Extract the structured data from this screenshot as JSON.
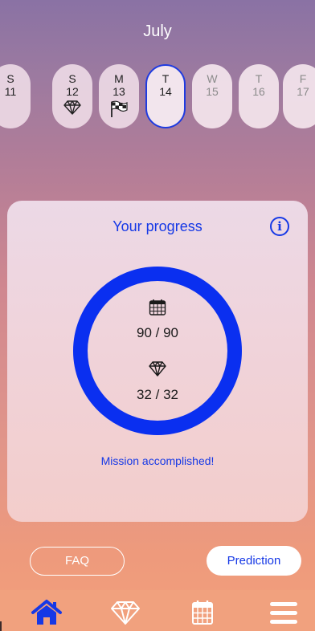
{
  "header": {
    "month": "July"
  },
  "days": [
    {
      "dow": "S",
      "num": "11",
      "marker": "",
      "state": "past"
    },
    {
      "dow": "S",
      "num": "12",
      "marker": "diamond-icon",
      "state": "past"
    },
    {
      "dow": "M",
      "num": "13",
      "marker": "checkered-flag-icon",
      "state": "past"
    },
    {
      "dow": "T",
      "num": "14",
      "marker": "",
      "state": "selected"
    },
    {
      "dow": "W",
      "num": "15",
      "marker": "",
      "state": "future"
    },
    {
      "dow": "T",
      "num": "16",
      "marker": "",
      "state": "future"
    },
    {
      "dow": "F",
      "num": "17",
      "marker": "",
      "state": "future"
    }
  ],
  "progress": {
    "title": "Your progress",
    "info_label": "i",
    "days_text": "90 / 90",
    "diamonds_text": "32 / 32",
    "completion_fraction": 1.0,
    "status": "Mission accomplished!"
  },
  "buttons": {
    "faq": "FAQ",
    "prediction": "Prediction"
  },
  "tabs": [
    "home-icon",
    "diamond-icon",
    "calendar-icon",
    "menu-icon"
  ],
  "colors": {
    "accent": "#1538e6",
    "ring": "#0a2ff0",
    "card": "#f0d3da"
  }
}
